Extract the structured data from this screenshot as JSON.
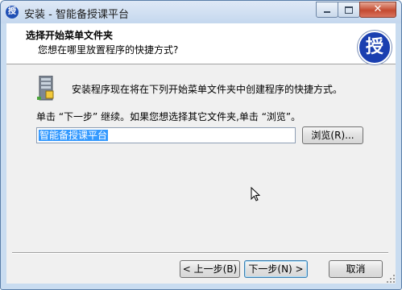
{
  "window": {
    "title": "安装 - 智能备授课平台",
    "app_icon_char": "授",
    "close_glyph": "✕"
  },
  "header": {
    "title": "选择开始菜单文件夹",
    "subtitle": "您想在哪里放置程序的快捷方式?",
    "badge_char": "授"
  },
  "body": {
    "line1": "安装程序现在将在下列开始菜单文件夹中创建程序的快捷方式。",
    "line2": "单击 “下一步” 继续。如果您想选择其它文件夹,单击 “浏览”。",
    "folder_value": "智能备授课平台"
  },
  "buttons": {
    "browse": "浏览(R)...",
    "back": "< 上一步(B)",
    "next": "下一步(N) >",
    "cancel": "取消"
  },
  "colors": {
    "badge": "#1a3fb0",
    "selection": "#3399ff"
  }
}
